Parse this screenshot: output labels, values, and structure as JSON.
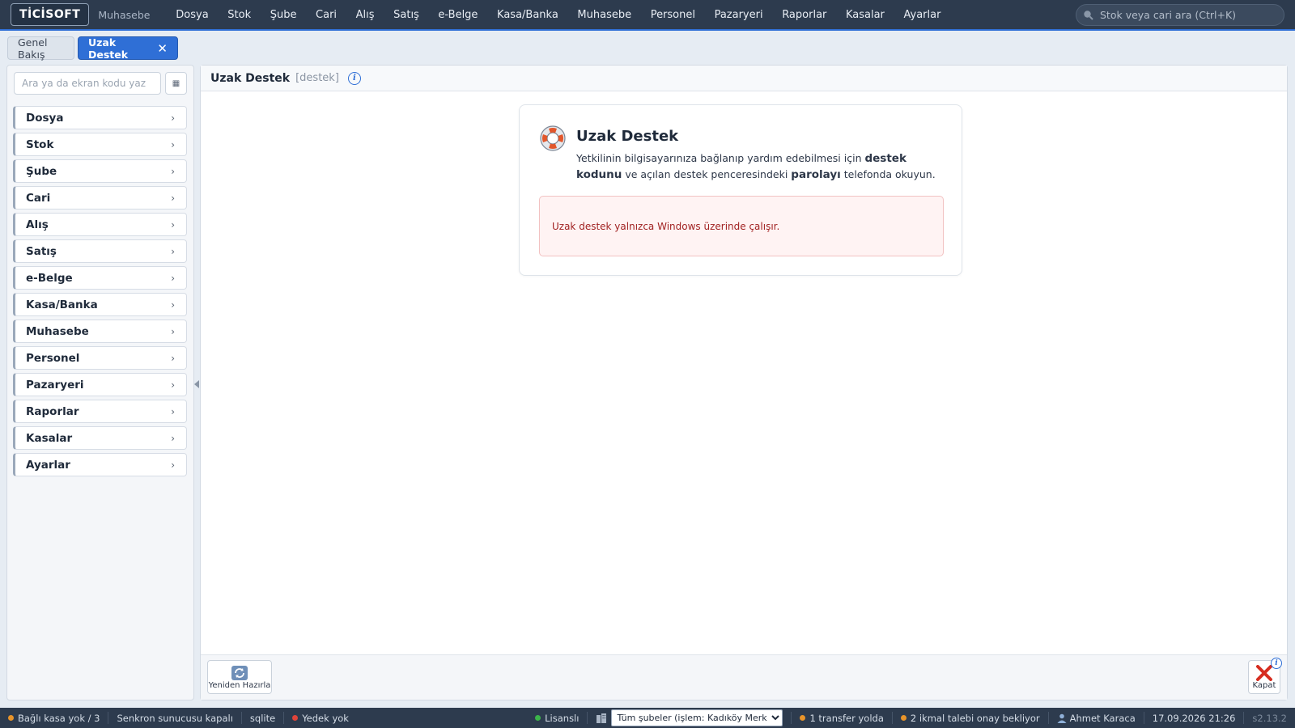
{
  "topbar": {
    "logo": "TİCİSOFT",
    "app_name": "Muhasebe",
    "menu": [
      "Dosya",
      "Stok",
      "Şube",
      "Cari",
      "Alış",
      "Satış",
      "e-Belge",
      "Kasa/Banka",
      "Muhasebe",
      "Personel",
      "Pazaryeri",
      "Raporlar",
      "Kasalar",
      "Ayarlar"
    ],
    "search_placeholder": "Stok veya cari ara (Ctrl+K)"
  },
  "tabs": {
    "overview": "Genel Bakış",
    "active": "Uzak Destek",
    "close_glyph": "✕"
  },
  "sidebar": {
    "search_placeholder": "Ara ya da ekran kodu yaz",
    "grid_glyph": "▦",
    "chevron_glyph": "›",
    "items": [
      "Dosya",
      "Stok",
      "Şube",
      "Cari",
      "Alış",
      "Satış",
      "e-Belge",
      "Kasa/Banka",
      "Muhasebe",
      "Personel",
      "Pazaryeri",
      "Raporlar",
      "Kasalar",
      "Ayarlar"
    ]
  },
  "main": {
    "title": "Uzak Destek",
    "code": "[destek]",
    "info_glyph": "i",
    "card": {
      "title": "Uzak Destek",
      "desc_part1": "Yetkilinin bilgisayarınıza bağlanıp yardım edebilmesi için ",
      "desc_bold1": "destek kodunu",
      "desc_part2": " ve açılan destek penceresindeki ",
      "desc_bold2": "parolayı",
      "desc_part3": " telefonda okuyun.",
      "alert": "Uzak destek yalnızca Windows üzerinde çalışır."
    },
    "footer": {
      "reload_label": "Yeniden Hazırla",
      "close_label": "Kapat",
      "close_badge": "i"
    }
  },
  "statusbar": {
    "cash": "Bağlı kasa yok / 3",
    "sync": "Senkron sunucusu kapalı",
    "db": "sqlite",
    "backup": "Yedek yok",
    "license": "Lisanslı",
    "branch_select": "Tüm şubeler (işlem: Kadıköy Merkez)",
    "transfer": "1 transfer yolda",
    "supply": "2 ikmal talebi onay bekliyor",
    "user": "Ahmet Karaca",
    "datetime": "17.09.2026 21:26",
    "version": "s2.13.2"
  },
  "colors": {
    "accent": "#2f6fd6",
    "topbar_bg": "#2d3b4e",
    "dot_orange": "#e8942a",
    "dot_red": "#e0443a",
    "dot_green": "#3bb54a",
    "alert_text": "#a12222"
  },
  "icons": {
    "global_search": "search-icon",
    "card": "lifebuoy-icon",
    "reload": "refresh-icon",
    "close": "red-x-icon",
    "user": "user-icon",
    "branch": "building-icon"
  }
}
